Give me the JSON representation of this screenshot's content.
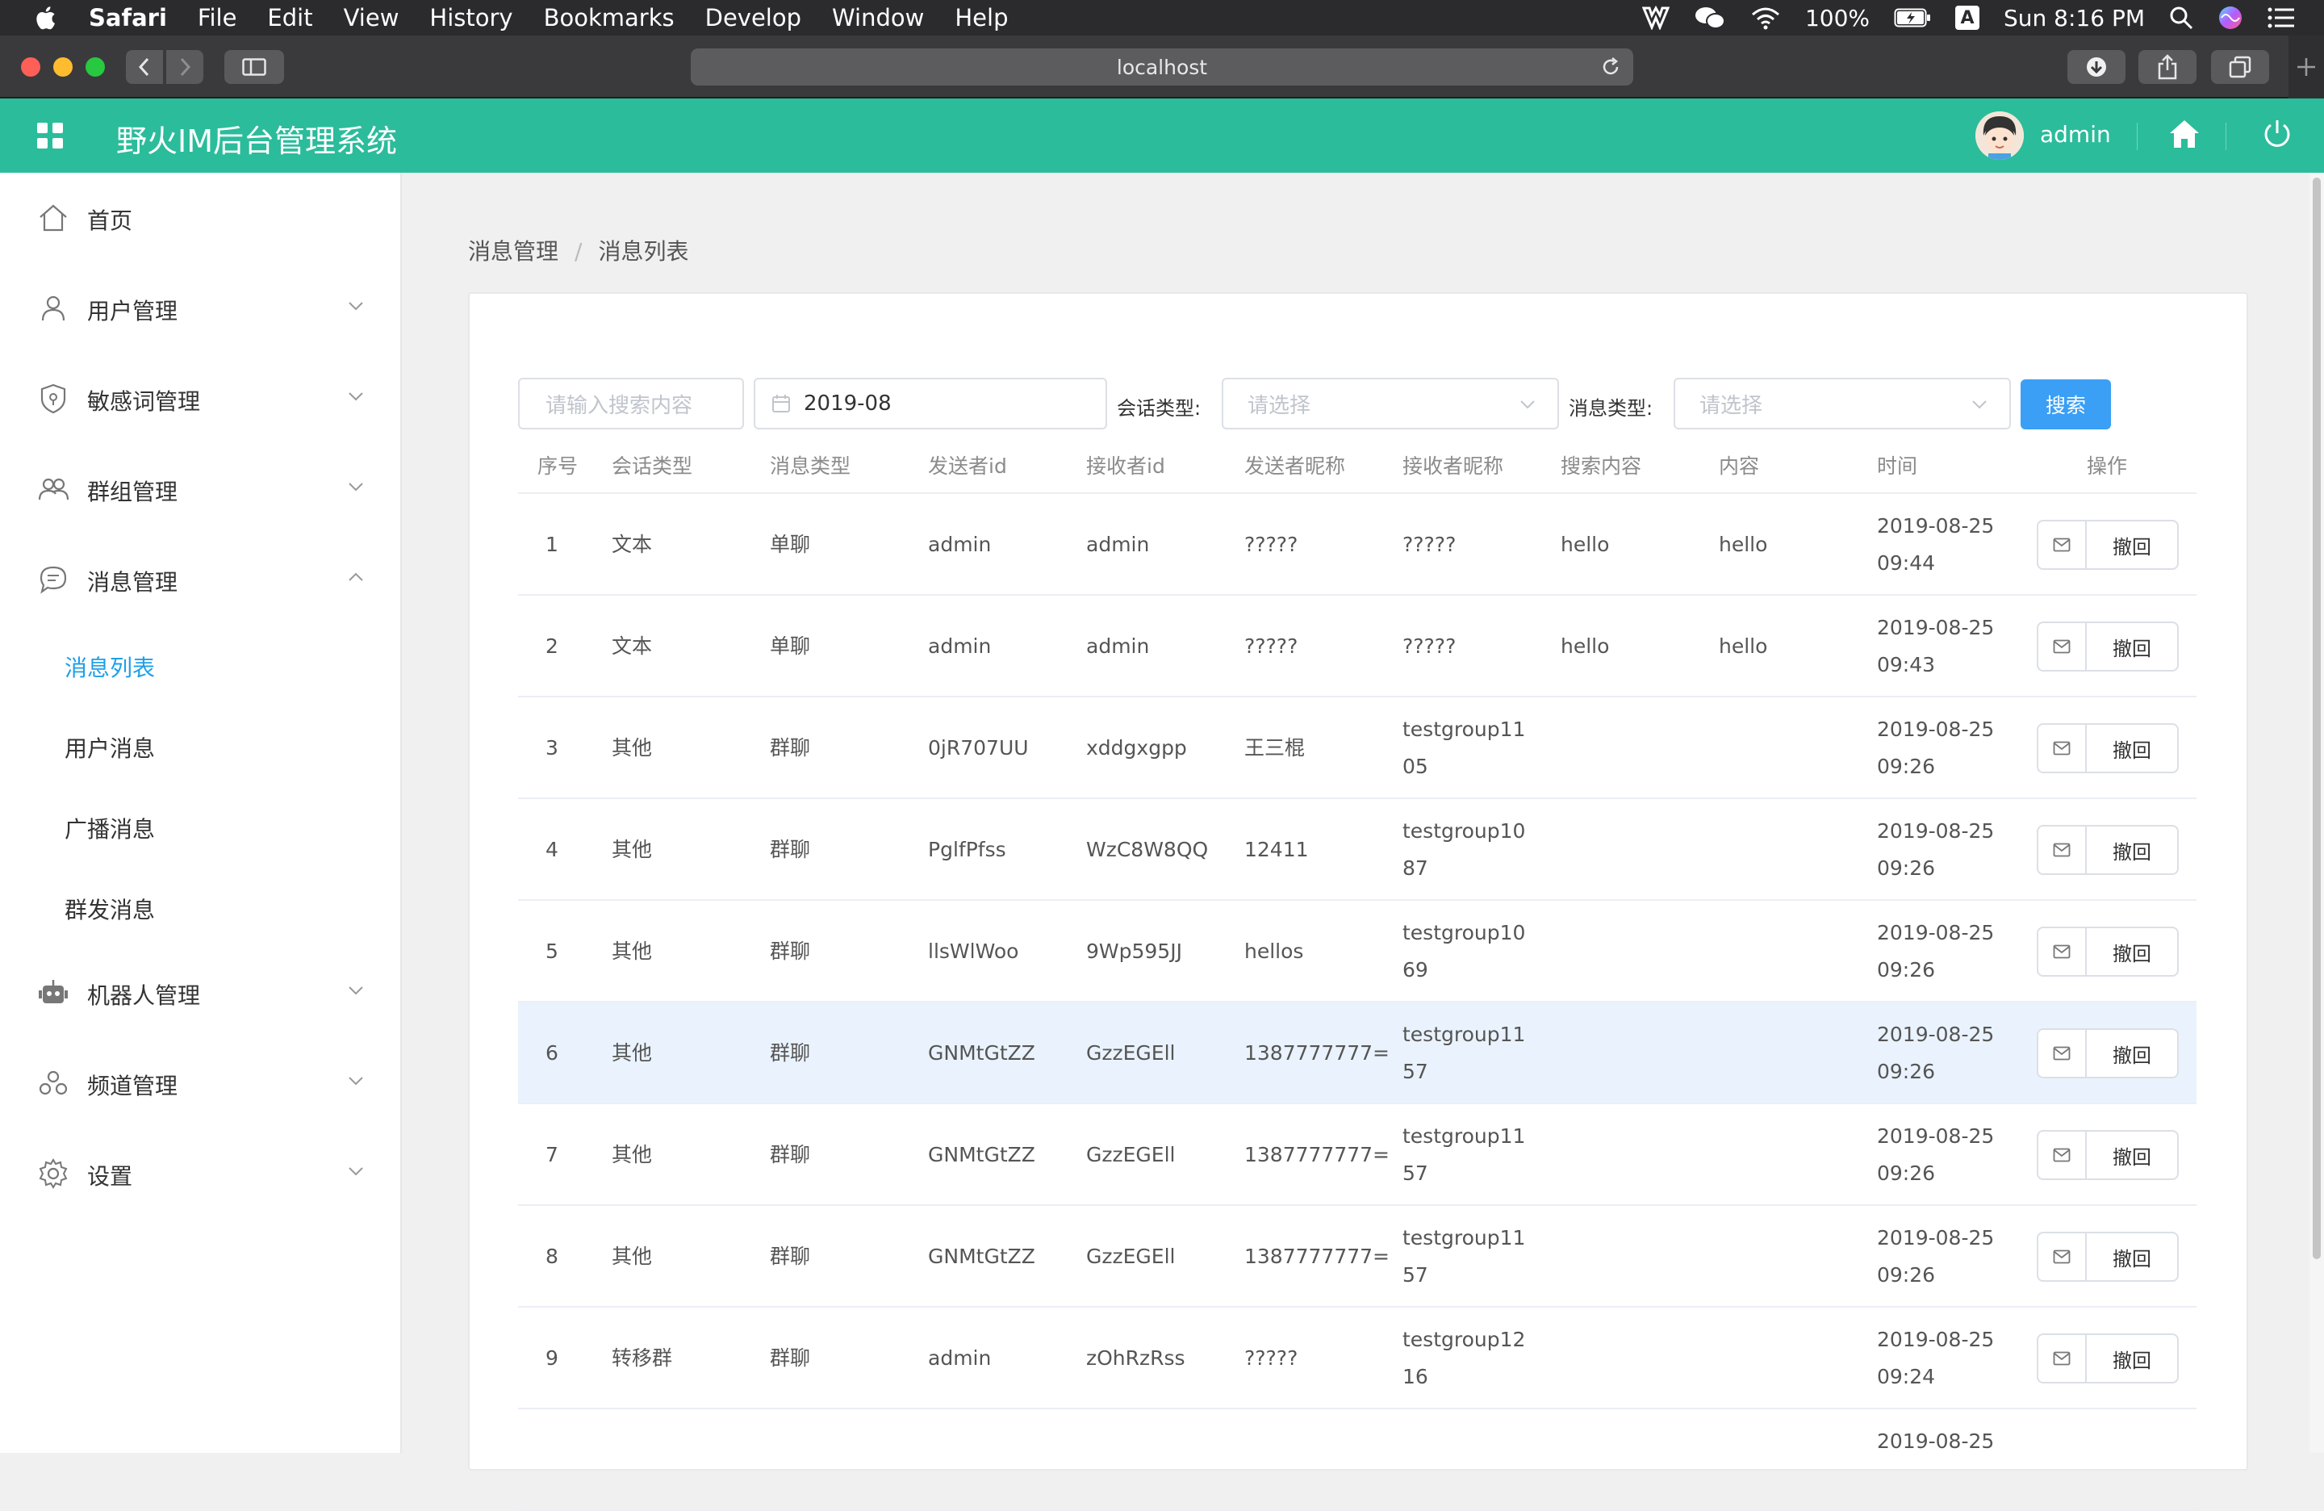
{
  "menubar": {
    "app": "Safari",
    "items": [
      "File",
      "Edit",
      "View",
      "History",
      "Bookmarks",
      "Develop",
      "Window",
      "Help"
    ],
    "battery": "100%",
    "input_badge": "A",
    "clock": "Sun 8:16 PM"
  },
  "browser": {
    "url": "localhost"
  },
  "app": {
    "title": "野火IM后台管理系统",
    "username": "admin",
    "accent_color": "#2bbc9b"
  },
  "sidebar": {
    "items": [
      {
        "label": "首页",
        "icon": "home-icon"
      },
      {
        "label": "用户管理",
        "icon": "user-icon"
      },
      {
        "label": "敏感词管理",
        "icon": "shield-icon"
      },
      {
        "label": "群组管理",
        "icon": "group-icon"
      },
      {
        "label": "消息管理",
        "icon": "message-icon"
      },
      {
        "label": "机器人管理",
        "icon": "robot-icon"
      },
      {
        "label": "频道管理",
        "icon": "channel-icon"
      },
      {
        "label": "设置",
        "icon": "gear-icon"
      }
    ],
    "subitems": [
      "消息列表",
      "用户消息",
      "广播消息",
      "群发消息"
    ],
    "active_subitem": "消息列表"
  },
  "breadcrumb": {
    "parent": "消息管理",
    "separator": "/",
    "current": "消息列表"
  },
  "filters": {
    "search_placeholder": "请输入搜索内容",
    "date_value": "2019-08",
    "conv_type_label": "会话类型:",
    "conv_type_placeholder": "请选择",
    "msg_type_label": "消息类型:",
    "msg_type_placeholder": "请选择",
    "search_button": "搜索"
  },
  "table": {
    "headers": [
      "序号",
      "会话类型",
      "消息类型",
      "发送者id",
      "接收者id",
      "发送者昵称",
      "接收者昵称",
      "搜索内容",
      "内容",
      "时间",
      "操作"
    ],
    "revoke_label": "撤回",
    "rows": [
      {
        "no": "1",
        "conv": "文本",
        "msg": "单聊",
        "sender": "admin",
        "receiver": "admin",
        "sender_nick": "?????",
        "receiver_nick": "?????",
        "search": "hello",
        "content": "hello",
        "date": "2019-08-25",
        "time": "09:44"
      },
      {
        "no": "2",
        "conv": "文本",
        "msg": "单聊",
        "sender": "admin",
        "receiver": "admin",
        "sender_nick": "?????",
        "receiver_nick": "?????",
        "search": "hello",
        "content": "hello",
        "date": "2019-08-25",
        "time": "09:43"
      },
      {
        "no": "3",
        "conv": "其他",
        "msg": "群聊",
        "sender": "0jR707UU",
        "receiver": "xddgxgpp",
        "sender_nick": "王三棍",
        "receiver_nick": "testgroup1105",
        "search": "",
        "content": "",
        "date": "2019-08-25",
        "time": "09:26"
      },
      {
        "no": "4",
        "conv": "其他",
        "msg": "群聊",
        "sender": "PglfPfss",
        "receiver": "WzC8W8QQ",
        "sender_nick": "12411",
        "receiver_nick": "testgroup1087",
        "search": "",
        "content": "",
        "date": "2019-08-25",
        "time": "09:26"
      },
      {
        "no": "5",
        "conv": "其他",
        "msg": "群聊",
        "sender": "llsWlWoo",
        "receiver": "9Wp595JJ",
        "sender_nick": "hellos",
        "receiver_nick": "testgroup1069",
        "search": "",
        "content": "",
        "date": "2019-08-25",
        "time": "09:26"
      },
      {
        "no": "6",
        "conv": "其他",
        "msg": "群聊",
        "sender": "GNMtGtZZ",
        "receiver": "GzzEGEll",
        "sender_nick": "1387777777=",
        "receiver_nick": "testgroup1157",
        "search": "",
        "content": "",
        "date": "2019-08-25",
        "time": "09:26"
      },
      {
        "no": "7",
        "conv": "其他",
        "msg": "群聊",
        "sender": "GNMtGtZZ",
        "receiver": "GzzEGEll",
        "sender_nick": "1387777777=",
        "receiver_nick": "testgroup1157",
        "search": "",
        "content": "",
        "date": "2019-08-25",
        "time": "09:26"
      },
      {
        "no": "8",
        "conv": "其他",
        "msg": "群聊",
        "sender": "GNMtGtZZ",
        "receiver": "GzzEGEll",
        "sender_nick": "1387777777=",
        "receiver_nick": "testgroup1157",
        "search": "",
        "content": "",
        "date": "2019-08-25",
        "time": "09:26"
      },
      {
        "no": "9",
        "conv": "转移群",
        "msg": "群聊",
        "sender": "admin",
        "receiver": "zOhRzRss",
        "sender_nick": "?????",
        "receiver_nick": "testgroup1216",
        "search": "",
        "content": "",
        "date": "2019-08-25",
        "time": "09:24"
      },
      {
        "no": "",
        "conv": "",
        "msg": "",
        "sender": "",
        "receiver": "",
        "sender_nick": "",
        "receiver_nick": "",
        "search": "",
        "content": "",
        "date": "2019-08-25",
        "time": ""
      }
    ]
  }
}
